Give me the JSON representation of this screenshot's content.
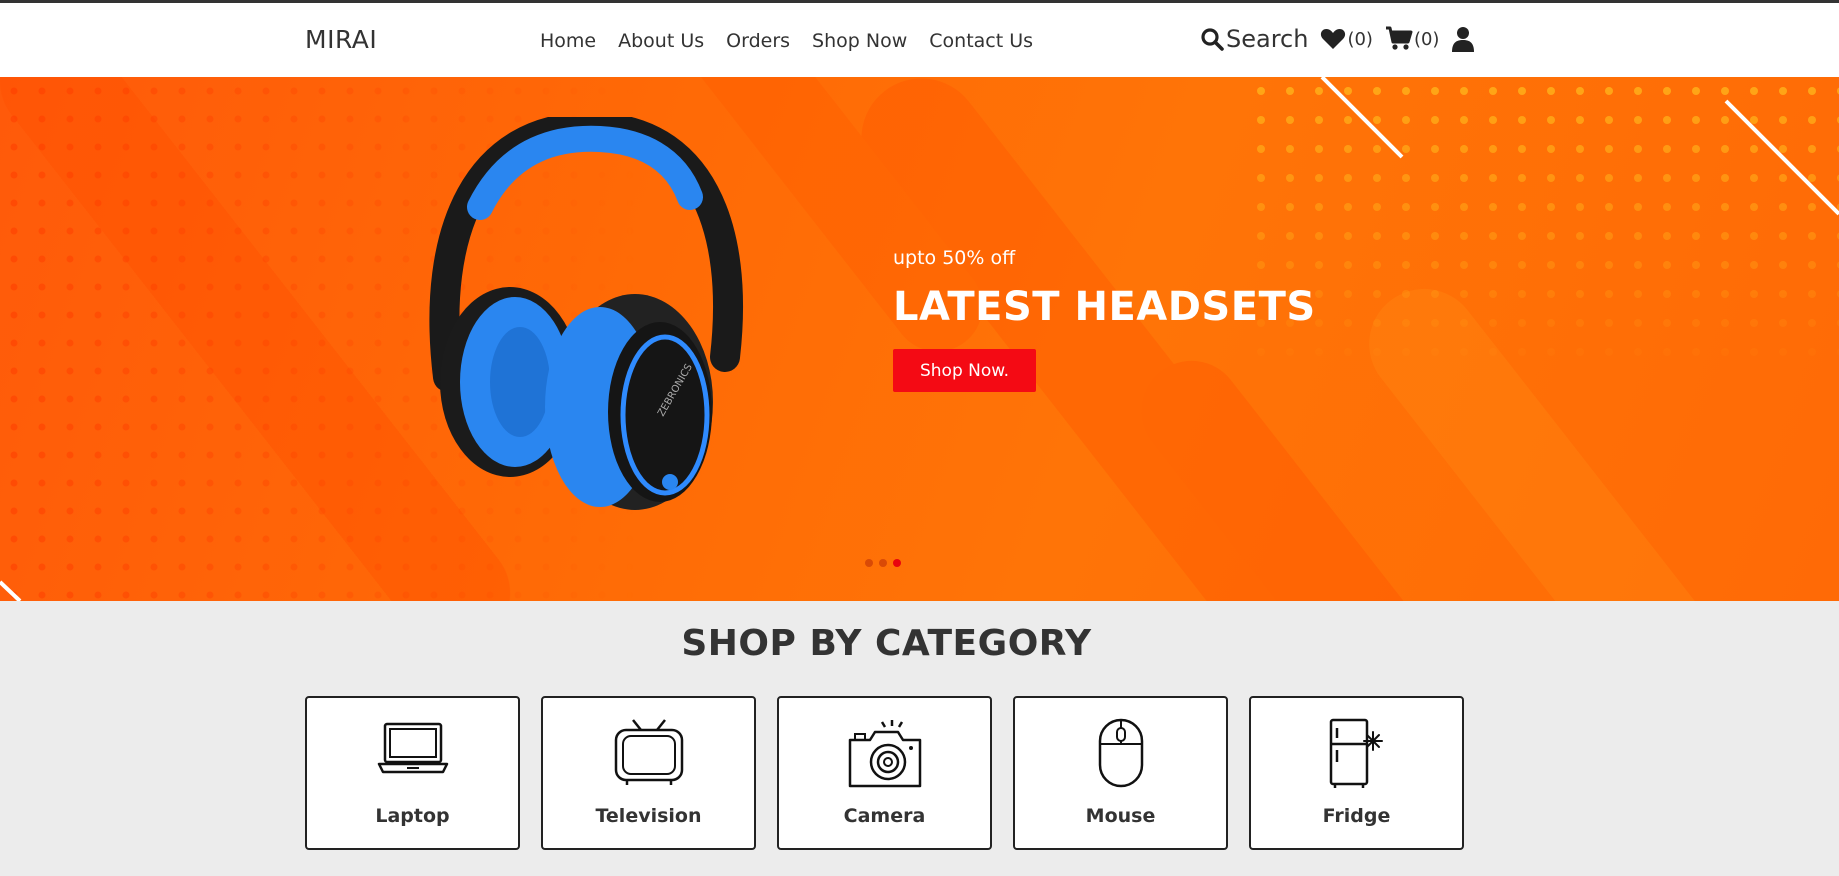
{
  "brand": {
    "logo": "MIRAI"
  },
  "nav": [
    {
      "label": "Home"
    },
    {
      "label": "About Us"
    },
    {
      "label": "Orders"
    },
    {
      "label": "Shop Now"
    },
    {
      "label": "Contact Us"
    }
  ],
  "tools": {
    "search_label": "Search",
    "wishlist_count": "(0)",
    "cart_count": "(0)"
  },
  "hero": {
    "subtitle": "upto 50% off",
    "title": "LATEST HEADSETS",
    "button_label": "Shop Now.",
    "product_brand": "ZEBRONICS",
    "slides": 3,
    "active_slide": 3,
    "colors": {
      "background": "#ff6a06",
      "button": "#f40a14"
    }
  },
  "categories": {
    "title": "SHOP BY CATEGORY",
    "items": [
      {
        "label": "Laptop",
        "icon": "laptop-icon"
      },
      {
        "label": "Television",
        "icon": "television-icon"
      },
      {
        "label": "Camera",
        "icon": "camera-icon"
      },
      {
        "label": "Mouse",
        "icon": "mouse-icon"
      },
      {
        "label": "Fridge",
        "icon": "fridge-icon"
      }
    ]
  }
}
